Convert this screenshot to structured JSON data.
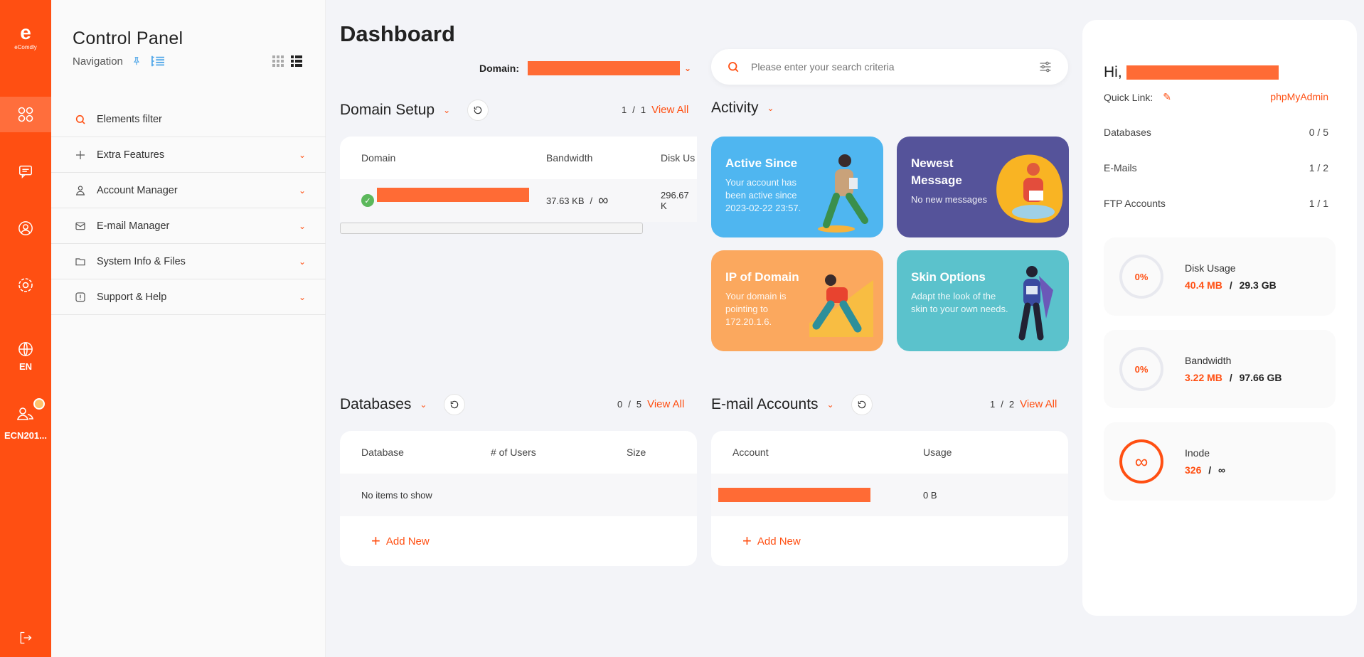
{
  "brand": {
    "letter": "e",
    "name": "eComdly"
  },
  "rail": {
    "lang": "EN",
    "user": "ECN201..."
  },
  "nav": {
    "title": "Control Panel",
    "subtitle": "Navigation",
    "items": [
      {
        "label": "Elements filter"
      },
      {
        "label": "Extra Features"
      },
      {
        "label": "Account Manager"
      },
      {
        "label": "E-mail Manager"
      },
      {
        "label": "System Info & Files"
      },
      {
        "label": "Support & Help"
      }
    ]
  },
  "header": {
    "title": "Dashboard",
    "domain_label": "Domain:",
    "search_placeholder": "Please enter your search criteria"
  },
  "domain_setup": {
    "title": "Domain Setup",
    "pager": {
      "current": "1",
      "sep": "/",
      "total": "1",
      "view_all": "View All"
    },
    "columns": [
      "Domain",
      "Bandwidth",
      "Disk Us"
    ],
    "row": {
      "bandwidth": "37.63 KB",
      "sep": "/",
      "bandwidth_limit": "∞",
      "disk": "296.67 K"
    }
  },
  "activity": {
    "title": "Activity",
    "tiles": [
      {
        "title": "Active Since",
        "text": "Your account has been active since 2023-02-22 23:57.",
        "color": "#4fb6f0"
      },
      {
        "title": "Newest Message",
        "text": "No new messages",
        "color": "#55539a"
      },
      {
        "title": "IP of Domain",
        "text": "Your domain is pointing to 172.20.1.6.",
        "color": "#fba85e"
      },
      {
        "title": "Skin Options",
        "text": "Adapt the look of the skin to your own needs.",
        "color": "#5bc2cc"
      }
    ]
  },
  "databases": {
    "title": "Databases",
    "pager": {
      "current": "0",
      "sep": "/",
      "total": "5",
      "view_all": "View All"
    },
    "columns": [
      "Database",
      "# of Users",
      "Size"
    ],
    "empty": "No items to show",
    "add": "Add New"
  },
  "emails": {
    "title": "E-mail Accounts",
    "pager": {
      "current": "1",
      "sep": "/",
      "total": "2",
      "view_all": "View All"
    },
    "columns": [
      "Account",
      "Usage"
    ],
    "row": {
      "usage": "0 B"
    },
    "add": "Add New"
  },
  "right": {
    "greeting": "Hi,",
    "quick_link_label": "Quick Link:",
    "quick_link_value": "phpMyAdmin",
    "stats": [
      {
        "label": "Databases",
        "value": "0 / 5"
      },
      {
        "label": "E-Mails",
        "value": "1 / 2"
      },
      {
        "label": "FTP Accounts",
        "value": "1 / 1"
      }
    ],
    "usage": [
      {
        "ring": "0%",
        "name": "Disk Usage",
        "used": "40.4 MB",
        "sep": "/",
        "limit": "29.3 GB"
      },
      {
        "ring": "0%",
        "name": "Bandwidth",
        "used": "3.22 MB",
        "sep": "/",
        "limit": "97.66 GB"
      },
      {
        "ring": "∞",
        "name": "Inode",
        "used": "326",
        "sep": "/",
        "limit": "∞"
      }
    ]
  },
  "colors": {
    "accent": "#ff4f12",
    "redaction": "#ff6b35"
  }
}
